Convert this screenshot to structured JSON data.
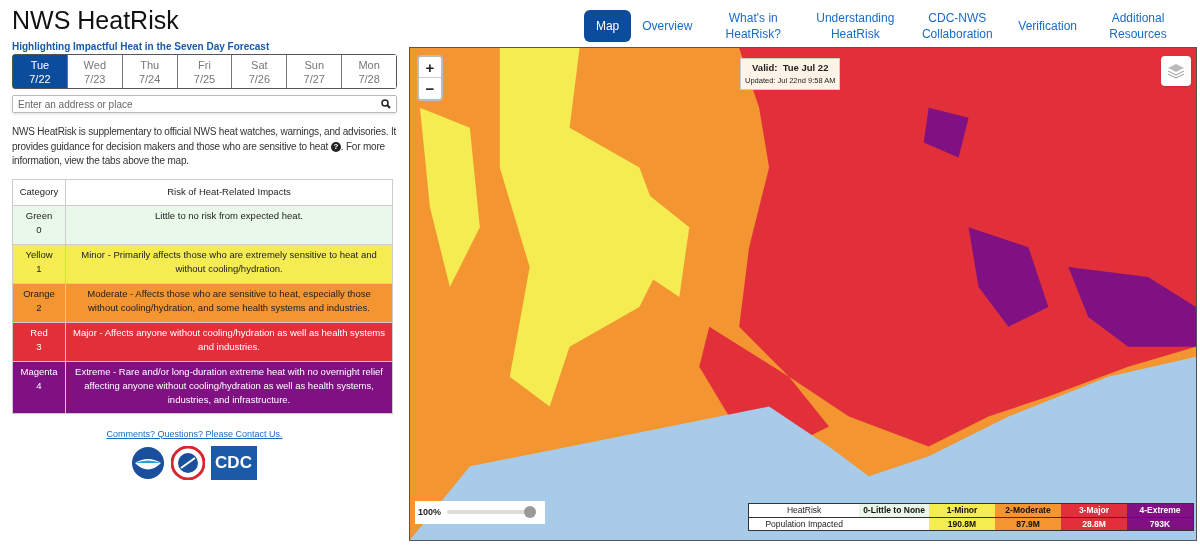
{
  "header": {
    "title": "NWS HeatRisk",
    "subtitle": "Highlighting Impactful Heat in the Seven Day Forecast"
  },
  "nav": [
    {
      "label": "Map",
      "selected": true
    },
    {
      "label": "Overview",
      "selected": false
    },
    {
      "label": "What's in HeatRisk?",
      "selected": false
    },
    {
      "label": "Understanding HeatRisk",
      "selected": false
    },
    {
      "label": "CDC-NWS Collaboration",
      "selected": false
    },
    {
      "label": "Verification",
      "selected": false
    },
    {
      "label": "Additional Resources",
      "selected": false
    }
  ],
  "days": [
    {
      "day": "Tue",
      "date": "7/22",
      "selected": true
    },
    {
      "day": "Wed",
      "date": "7/23",
      "selected": false
    },
    {
      "day": "Thu",
      "date": "7/24",
      "selected": false
    },
    {
      "day": "Fri",
      "date": "7/25",
      "selected": false
    },
    {
      "day": "Sat",
      "date": "7/26",
      "selected": false
    },
    {
      "day": "Sun",
      "date": "7/27",
      "selected": false
    },
    {
      "day": "Mon",
      "date": "7/28",
      "selected": false
    }
  ],
  "search": {
    "placeholder": "Enter an address or place"
  },
  "intro": {
    "before": "NWS HeatRisk is supplementary to official NWS heat watches, warnings, and advisories. It provides guidance for decision makers and those who are sensitive to heat",
    "help": "?",
    "after": ". For more information, view the tabs above the map."
  },
  "table": {
    "columns": [
      "Category",
      "Risk of Heat-Related Impacts"
    ],
    "rows": [
      {
        "name": "Green",
        "level_number": "0",
        "description": "Little to no risk from expected heat.",
        "color": "#e9f8e9"
      },
      {
        "name": "Yellow",
        "level_number": "1",
        "description": "Minor - Primarily affects those who are extremely sensitive to heat and without cooling/hydration.",
        "color": "#f5ec52"
      },
      {
        "name": "Orange",
        "level_number": "2",
        "description": "Moderate - Affects those who are sensitive to heat, especially those without cooling/hydration, and some health systems and industries.",
        "color": "#f39530"
      },
      {
        "name": "Red",
        "level_number": "3",
        "description": "Major - Affects anyone without cooling/hydration as well as health systems and industries.",
        "color": "#e2303a"
      },
      {
        "name": "Magenta",
        "level_number": "4",
        "description": "Extreme - Rare and/or long-duration extreme heat with no overnight relief affecting anyone without cooling/hydration as well as health systems, industries, and infrastructure.",
        "color": "#7f1182"
      }
    ]
  },
  "contact_link": "Comments? Questions? Please Contact Us.",
  "cdc_logo_text": "CDC",
  "map": {
    "zoom_in": "+",
    "zoom_out": "−",
    "valid_label": "Valid:",
    "valid_date": "Tue  Jul 22",
    "updated": "Updated: Jul 22nd 9:58 AM",
    "opacity": {
      "reading": "100%",
      "level": 1
    },
    "legend": {
      "row_labels": [
        "HeatRisk",
        "Population Impacted"
      ],
      "levels": [
        {
          "label": "0-Little to None",
          "color": "#e9f8e9"
        },
        {
          "label": "1-Minor",
          "population": "190.8M",
          "color": "#f5ec52"
        },
        {
          "label": "2-Moderate",
          "population": "87.9M",
          "color": "#f39530"
        },
        {
          "label": "3-Major",
          "population": "28.8M",
          "color": "#e2303a"
        },
        {
          "label": "4-Extreme",
          "population": "793K",
          "color": "#7f1182"
        }
      ]
    }
  }
}
